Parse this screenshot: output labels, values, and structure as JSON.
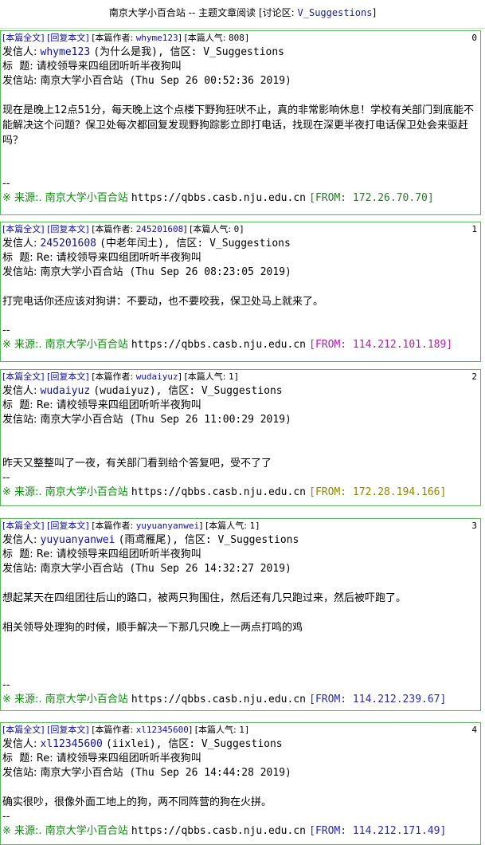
{
  "page_title_prefix": "南京大学小百合站 -- 主题文章阅读 [讨论区: ",
  "page_title_board": "V_Suggestions",
  "page_title_suffix": "]",
  "labels": {
    "full_text": "[本篇全文]",
    "reply": "[回复本文]",
    "author": "[本篇作者:",
    "popularity": "[本篇人气:",
    "sender": "发信人:",
    "title": "标  题:",
    "station": "发信站:",
    "source_prefix": "※ 来源:.",
    "source_site": "南京大学小百合站",
    "source_url": "https://qbbs.casb.nju.edu.cn",
    "sig": "--"
  },
  "posts": [
    {
      "index": "0",
      "author": "whyme123",
      "popularity": "808]",
      "sender": "whyme123",
      "nickname": "(为什么是我), 信区: V_Suggestions",
      "title": "请校领导来四组团听听半夜狗叫",
      "time": "南京大学小百合站 (Thu Sep 26 00:52:36 2019)",
      "content": "现在是晚上12点51分，每天晚上这个点楼下野狗狂吠不止，真的非常影响休息！学校有关部门到底能不能解决这个问题？保卫处每次都回复发现野狗踪影立即打电话，找现在深更半夜打电话保卫处会来驱赶吗？",
      "from": "[FROM: 172.26.70.70]"
    },
    {
      "index": "1",
      "author": "245201608",
      "popularity": "0]",
      "sender": "245201608",
      "nickname": "(中老年闰土), 信区: V_Suggestions",
      "title": "Re: 请校领导来四组团听听半夜狗叫",
      "time": "南京大学小百合站 (Thu Sep 26 08:23:05 2019)",
      "content": "打完电话你还应该对狗讲：不要动，也不要咬我，保卫处马上就来了。",
      "from": "[FROM: 114.212.101.189]"
    },
    {
      "index": "2",
      "author": "wudaiyuz",
      "popularity": "1]",
      "sender": "wudaiyuz",
      "nickname": "(wudaiyuz), 信区: V_Suggestions",
      "title": "Re: 请校领导来四组团听听半夜狗叫",
      "time": "南京大学小百合站 (Thu Sep 26 11:00:29 2019)",
      "content": "昨天又整整叫了一夜，有关部门看到给个答复吧，受不了了",
      "from": "[FROM: 172.28.194.166]"
    },
    {
      "index": "3",
      "author": "yuyuanyanwei",
      "popularity": "1]",
      "sender": "yuyuanyanwei",
      "nickname": "(雨鸢雁尾), 信区: V_Suggestions",
      "title": "Re: 请校领导来四组团听听半夜狗叫",
      "time": "南京大学小百合站 (Thu Sep 26 14:32:27 2019)",
      "content": "想起某天在四组团往后山的路口，被两只狗围住，然后还有几只跑过来，然后被吓跑了。",
      "content2": "相关领导处理狗的时候，顺手解决一下那几只晚上一两点打鸣的鸡",
      "from": "[FROM: 114.212.239.67]"
    },
    {
      "index": "4",
      "author": "xl12345600",
      "popularity": "1]",
      "sender": "xl12345600",
      "nickname": "(iixlei), 信区: V_Suggestions",
      "title": "Re: 请校领导来四组团听听半夜狗叫",
      "time": "南京大学小百合站 (Thu Sep 26 14:44:28 2019)",
      "content": "确实很吵，很像外面工地上的狗，两不同阵营的狗在火拼。",
      "from": "[FROM: 114.212.171.49]"
    }
  ]
}
